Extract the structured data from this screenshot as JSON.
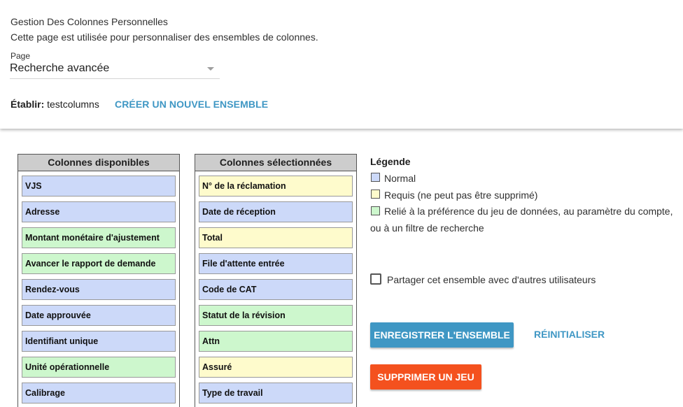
{
  "header": {
    "title": "Gestion Des Colonnes Personnelles",
    "description": "Cette page est utilisée pour personnaliser des ensembles de colonnes.",
    "page_label": "Page",
    "page_value": "Recherche avancée",
    "establish_label": "Établir:",
    "establish_value": "testcolumns",
    "create_link": "CRÉER UN NOUVEL ENSEMBLE"
  },
  "available": {
    "title": "Colonnes disponibles",
    "items": [
      {
        "label": "VJS",
        "type": "normal"
      },
      {
        "label": "Adresse",
        "type": "normal"
      },
      {
        "label": "Montant monétaire d'ajustement",
        "type": "linked"
      },
      {
        "label": "Avancer le rapport de demande",
        "type": "linked"
      },
      {
        "label": "Rendez-vous",
        "type": "normal"
      },
      {
        "label": "Date approuvée",
        "type": "normal"
      },
      {
        "label": "Identifiant unique",
        "type": "normal"
      },
      {
        "label": "Unité opérationnelle",
        "type": "linked"
      },
      {
        "label": "Calibrage",
        "type": "normal"
      }
    ]
  },
  "selected": {
    "title": "Colonnes sélectionnées",
    "items": [
      {
        "label": "N° de la réclamation",
        "type": "required"
      },
      {
        "label": "Date de réception",
        "type": "normal"
      },
      {
        "label": "Total",
        "type": "required"
      },
      {
        "label": "File d'attente entrée",
        "type": "normal"
      },
      {
        "label": "Code de CAT",
        "type": "normal"
      },
      {
        "label": "Statut de la révision",
        "type": "linked"
      },
      {
        "label": "Attn",
        "type": "linked"
      },
      {
        "label": "Assuré",
        "type": "required"
      },
      {
        "label": "Type de travail",
        "type": "normal"
      }
    ]
  },
  "legend": {
    "title": "Légende",
    "normal": "Normal",
    "required": "Requis (ne peut pas être supprimé)",
    "linked": "Relié à la préférence du jeu de données, au paramètre du compte, ou à un filtre de recherche"
  },
  "share_label": "Partager cet ensemble avec d'autres utilisateurs",
  "buttons": {
    "save": "ENREGISTRER L'ENSEMBLE",
    "reset": "RÉINITIALISER",
    "delete": "SUPPRIMER UN JEU"
  },
  "colors": {
    "normal": "#ccd9f9",
    "required": "#fefbcc",
    "linked": "#cdf7cd",
    "accent": "#3f97c4",
    "danger": "#f4511e"
  }
}
